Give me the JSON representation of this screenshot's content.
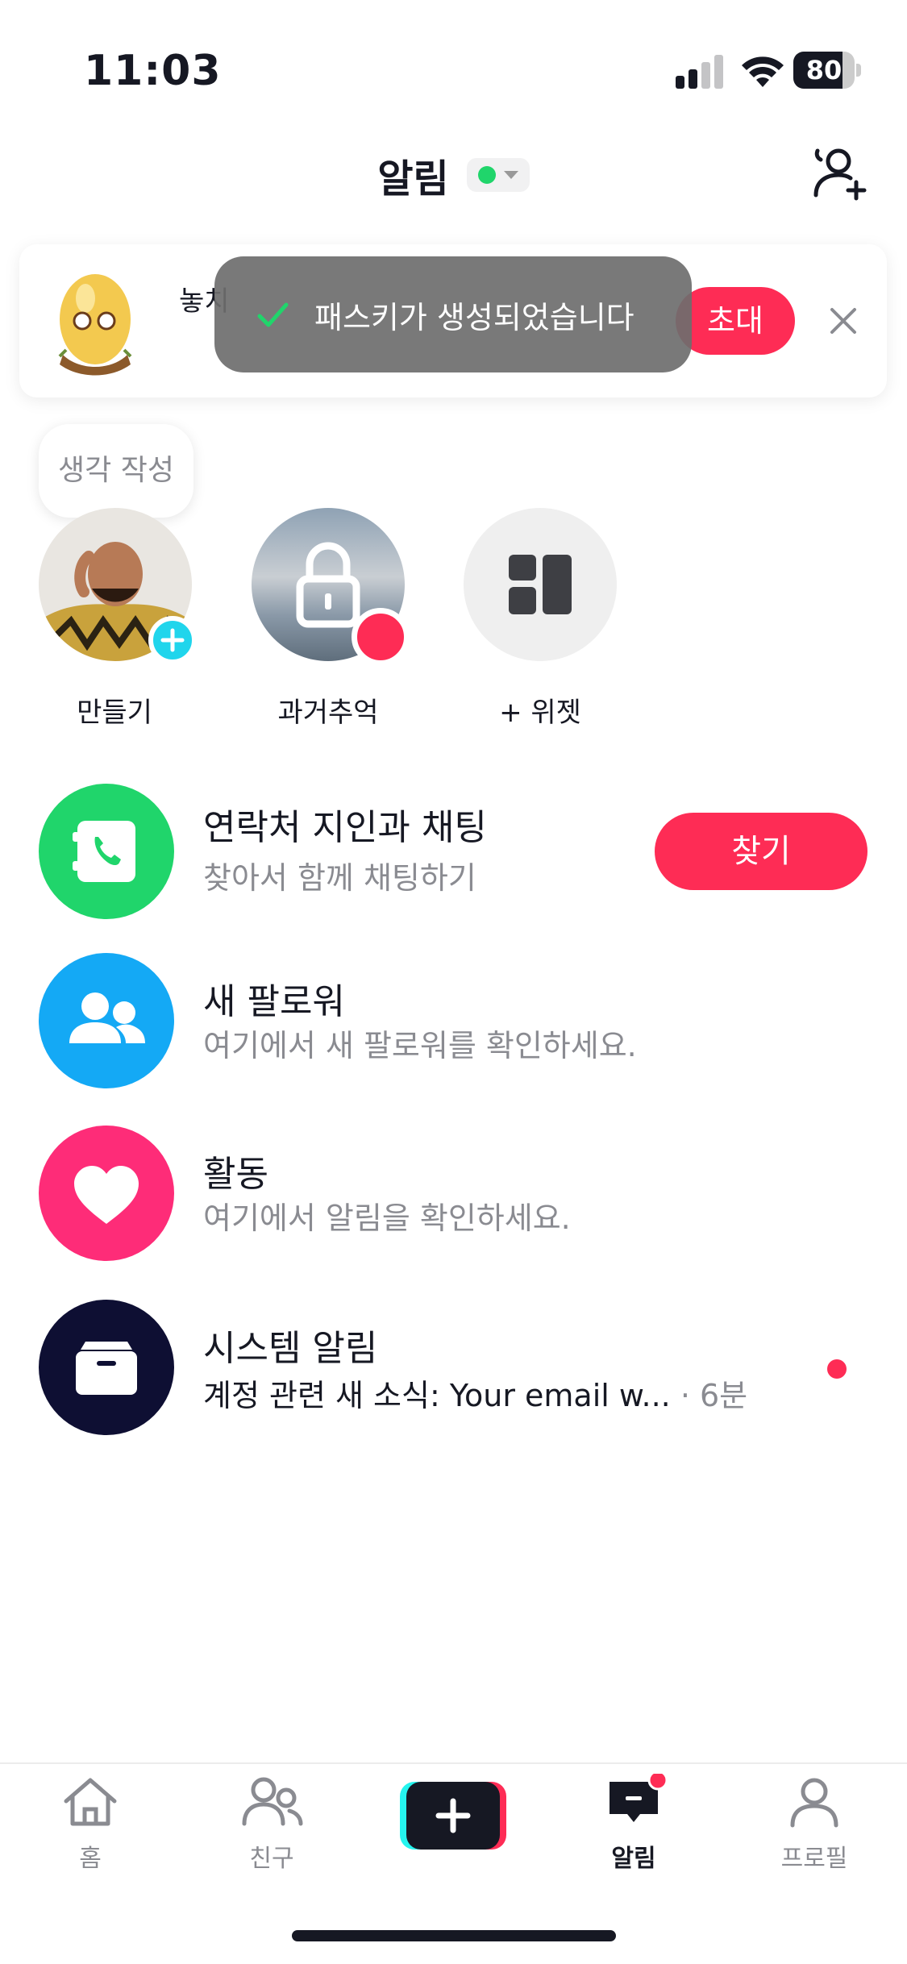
{
  "status_bar": {
    "time": "11:03",
    "battery": "80",
    "battery_level": 0.8
  },
  "header": {
    "title": "알림"
  },
  "banner": {
    "text": "놓치 께",
    "invite_label": "초대"
  },
  "toast": {
    "text": "패스키가 생성되었습니다"
  },
  "stories": {
    "bubble_text": "생각 작성",
    "items": [
      {
        "label": "만들기"
      },
      {
        "label": "과거추억"
      },
      {
        "label": "+ 위젯"
      }
    ]
  },
  "rows": [
    {
      "title": "연락처 지인과 채팅",
      "subtitle": "찾아서 함께 채팅하기",
      "action": "찾기",
      "color": "#20d56b",
      "icon": "phone-contact-icon"
    },
    {
      "title": "새 팔로워",
      "subtitle": "여기에서 새 팔로워를 확인하세요.",
      "color": "#14a9f5",
      "icon": "followers-icon"
    },
    {
      "title": "활동",
      "subtitle": "여기에서 알림을 확인하세요.",
      "color": "#fe2c78",
      "icon": "heart-icon"
    },
    {
      "title": "시스템 알림",
      "subtitle": "계정 관련 새 소식: Your email w...",
      "time": "· 6분",
      "color": "#0e0f33",
      "icon": "inbox-icon"
    }
  ],
  "tabbar": {
    "tabs": [
      {
        "label": "홈",
        "icon": "home-icon"
      },
      {
        "label": "친구",
        "icon": "friends-icon"
      },
      {
        "label": "",
        "icon": "create-icon"
      },
      {
        "label": "알림",
        "icon": "inbox-tab-icon",
        "active": true
      },
      {
        "label": "프로필",
        "icon": "profile-icon"
      }
    ]
  }
}
